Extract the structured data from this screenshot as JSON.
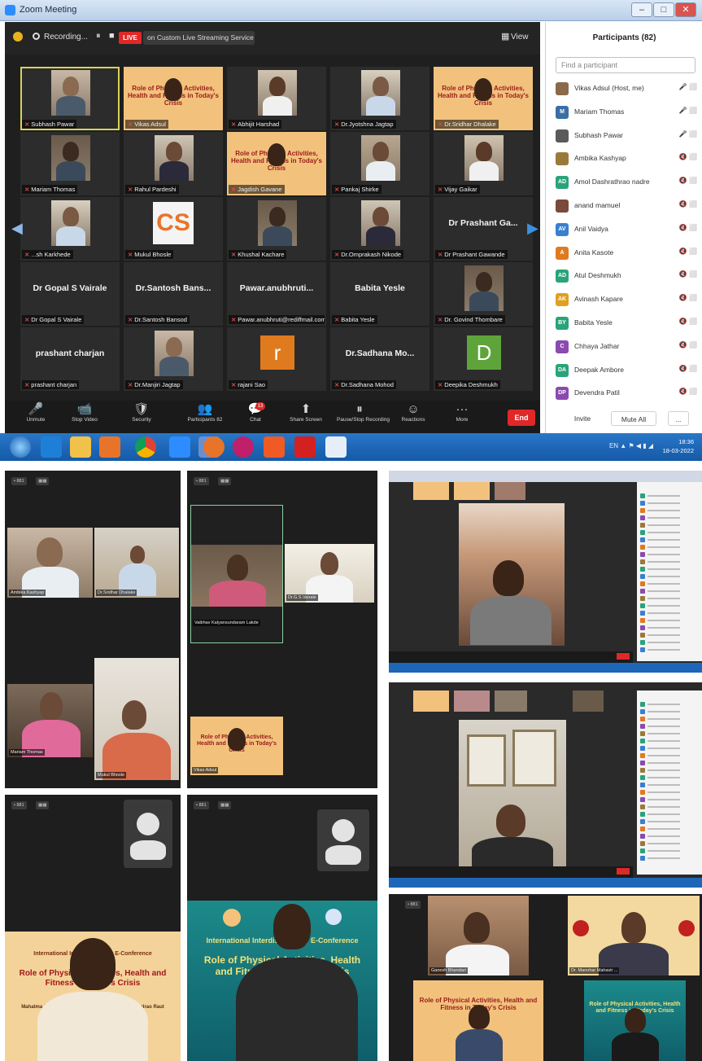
{
  "window": {
    "title": "Zoom Meeting",
    "min": "–",
    "max": "□",
    "close": "✕"
  },
  "topbar": {
    "recording": "Recording...",
    "live": "LIVE",
    "stream": "on Custom Live Streaming Service",
    "view": "View"
  },
  "tiles": [
    {
      "name": "Subhash Pawar",
      "type": "cam",
      "active": true
    },
    {
      "name": "Vikas Adsul",
      "type": "poster"
    },
    {
      "name": "Abhijit Harshad",
      "type": "cam"
    },
    {
      "name": "Dr.Jyotshna Jagtap",
      "type": "cam"
    },
    {
      "name": "Dr.Sridhar Dhalake",
      "type": "poster"
    },
    {
      "name": "Mariam Thomas",
      "type": "cam"
    },
    {
      "name": "Rahul Pardeshi",
      "type": "cam"
    },
    {
      "name": "Jagdish Gavane",
      "type": "poster"
    },
    {
      "name": "Pankaj Shirke",
      "type": "cam"
    },
    {
      "name": "Vijay Gaikar",
      "type": "cam"
    },
    {
      "name": "...sh Karkhede",
      "type": "cam"
    },
    {
      "name": "Mukul Bhosle",
      "type": "logo"
    },
    {
      "name": "Khushal Kachare",
      "type": "cam"
    },
    {
      "name": "Dr.Omprakash Nikode",
      "type": "cam"
    },
    {
      "name": "Dr Prashant Gawande",
      "type": "text",
      "big": "Dr Prashant Ga..."
    },
    {
      "name": "Dr Gopal S Vairale",
      "type": "text",
      "big": "Dr Gopal S Vairale"
    },
    {
      "name": "Dr.Santosh Bansod",
      "type": "text",
      "big": "Dr.Santosh Bans..."
    },
    {
      "name": "Pawar.anubhruti@rediffmail.com",
      "type": "text",
      "big": "Pawar.anubhruti..."
    },
    {
      "name": "Babita Yesle",
      "type": "text",
      "big": "Babita Yesle"
    },
    {
      "name": "Dr. Govind Thombare",
      "type": "cam"
    },
    {
      "name": "prashant charjan",
      "type": "text",
      "big": "prashant charjan"
    },
    {
      "name": "Dr.Manjiri Jagtap",
      "type": "cam"
    },
    {
      "name": "rajani Sao",
      "type": "letter",
      "letter": "r",
      "color": "#e07a1f"
    },
    {
      "name": "Dr.Sadhana Mohod",
      "type": "text",
      "big": "Dr.Sadhana Mo..."
    },
    {
      "name": "Deepika Deshmukh",
      "type": "letter",
      "letter": "D",
      "color": "#5ea43a"
    }
  ],
  "controls": [
    {
      "label": "Unmute",
      "icon": "🎤"
    },
    {
      "label": "Stop Video",
      "icon": "📹"
    },
    {
      "label": "Security",
      "icon": "🛡"
    },
    {
      "label": "Participants",
      "icon": "👥",
      "count": "82"
    },
    {
      "label": "Chat",
      "icon": "💬"
    },
    {
      "label": "Share Screen",
      "icon": "⬆"
    },
    {
      "label": "Pause/Stop Recording",
      "icon": "⏸"
    },
    {
      "label": "Reactions",
      "icon": "☺"
    },
    {
      "label": "More",
      "icon": "···"
    }
  ],
  "chat_badge": "13",
  "end_label": "End",
  "panel": {
    "title": "Participants (82)",
    "search_placeholder": "Find a participant",
    "participants": [
      {
        "name": "Vikas Adsul (Host, me)",
        "initials": "",
        "color": "#8a6a4a",
        "status": "🎤 ⬜"
      },
      {
        "name": "Mariam Thomas",
        "initials": "M",
        "color": "#3a6ea5",
        "status": "🎤 ⬜"
      },
      {
        "name": "Subhash Pawar",
        "initials": "",
        "color": "#5a5a5a",
        "status": "🎤 ⬜"
      },
      {
        "name": "Ambika Kashyap",
        "initials": "",
        "color": "#9a7a3a",
        "status": "🔇 ⬜"
      },
      {
        "name": "Amol Dashrathrao nadre",
        "initials": "AD",
        "color": "#2aa37a",
        "status": "🔇 ⬜"
      },
      {
        "name": "anand mamuel",
        "initials": "",
        "color": "#7a4a3a",
        "status": "🔇 ⬜"
      },
      {
        "name": "Anil Vaidya",
        "initials": "AV",
        "color": "#3a7fd0",
        "status": "🔇 ⬜"
      },
      {
        "name": "Anita Kasote",
        "initials": "A",
        "color": "#e07a1f",
        "status": "🔇 ⬜"
      },
      {
        "name": "Atul Deshmukh",
        "initials": "AD",
        "color": "#2aa37a",
        "status": "🔇 ⬜"
      },
      {
        "name": "Avinash Kapare",
        "initials": "AK",
        "color": "#e0a020",
        "status": "🔇 ⬜"
      },
      {
        "name": "Babita Yesle",
        "initials": "BY",
        "color": "#2aa37a",
        "status": "🔇 ⬜"
      },
      {
        "name": "Chhaya Jathar",
        "initials": "C",
        "color": "#8a4ab0",
        "status": "🔇 ⬜"
      },
      {
        "name": "Deepak Ambore",
        "initials": "DA",
        "color": "#2aa37a",
        "status": "🔇 ⬜"
      },
      {
        "name": "Devendra Patil",
        "initials": "DP",
        "color": "#8a4ab0",
        "status": "🔇 ⬜"
      }
    ],
    "invite": "Invite",
    "mute_all": "Mute All",
    "more": "..."
  },
  "taskbar": {
    "time": "18:36",
    "date": "18-03-2022",
    "tray": "EN ▲ ⚑ ◀ ▮ ◢"
  },
  "collage": {
    "poster_heading": "International Interdisciplinary E-Conference",
    "poster_title": "Role of Physical Activities, Health and Fitness in Today's Crisis",
    "college": "Mahatma Jyotiba Phule Commerce, Science & Vitthalrao Raut Arts College",
    "s1_tags": [
      "Ambika Kashyap",
      "Dr.Sridhar Dhalake",
      "Mariam Thomas",
      "Mukul Bhosle"
    ],
    "s2_tags": [
      "Vaibhav Kalyansundaram Lakde",
      "Dr.G.S.Vairale",
      "Vikas Adsul"
    ],
    "s3_label": "Ganesh Bhandari",
    "s4_label": "Dr. Manohar Mahavir ..."
  }
}
